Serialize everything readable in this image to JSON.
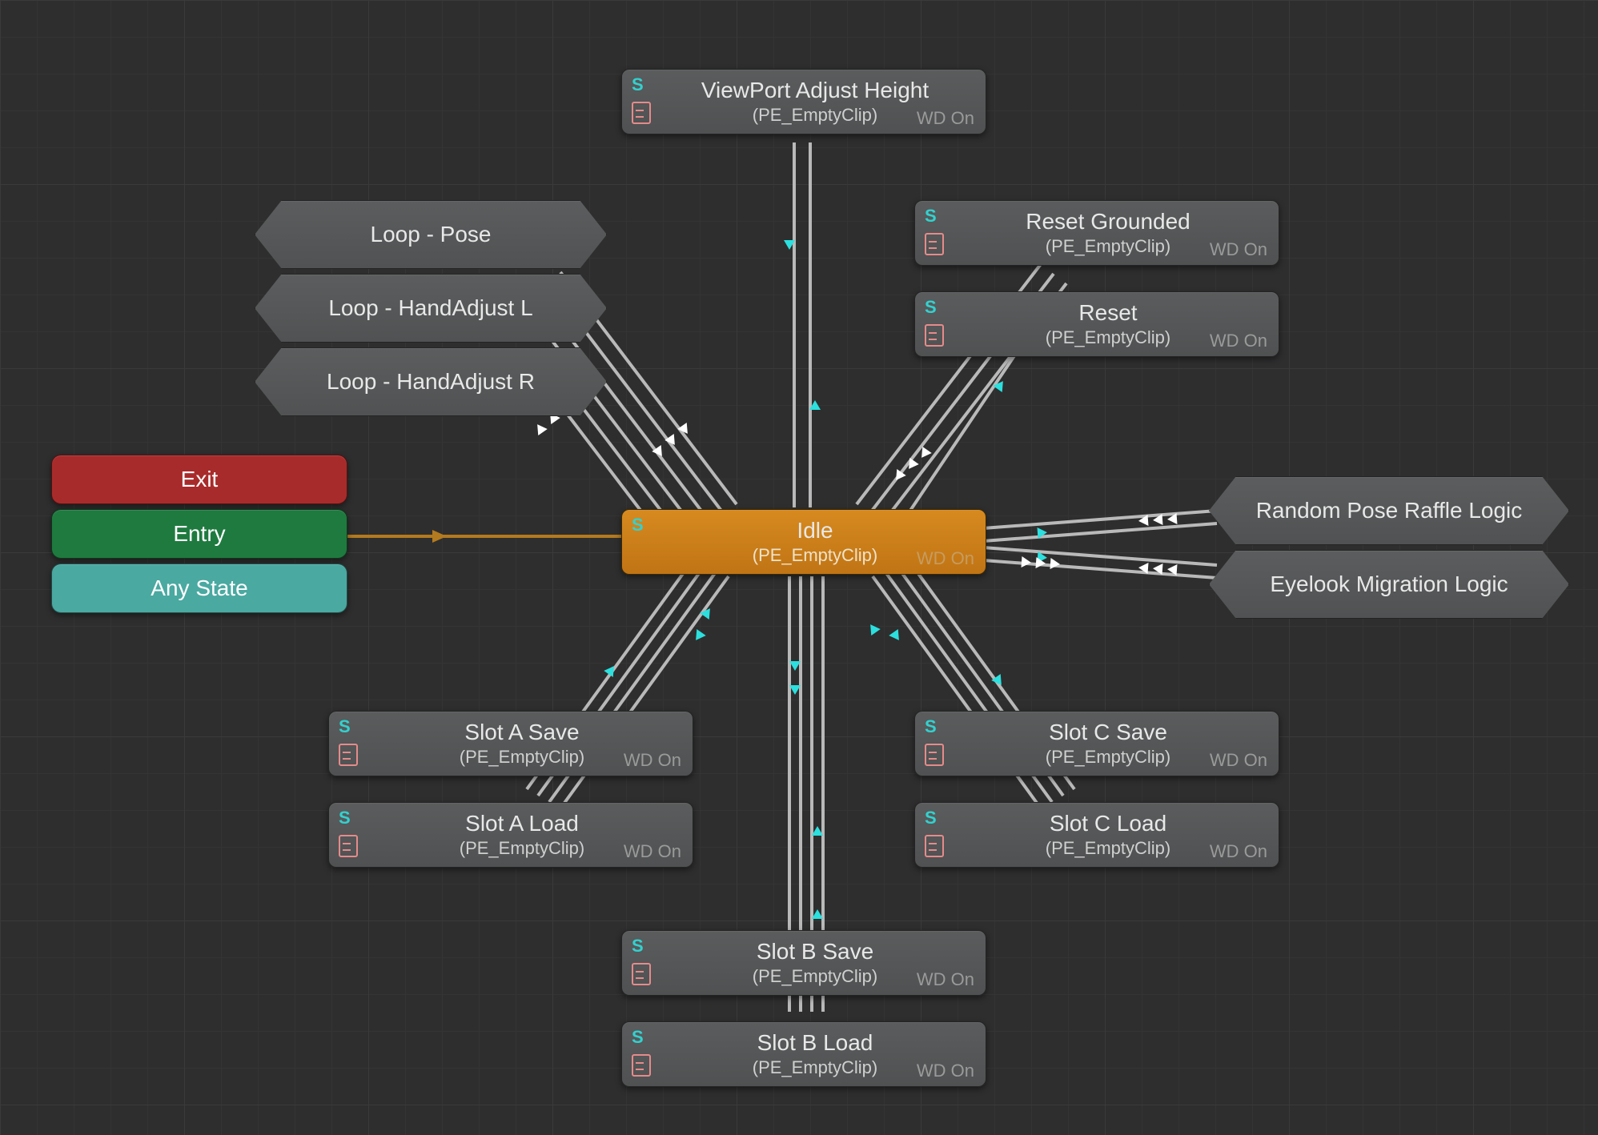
{
  "wd_on": "WD On",
  "s_glyph": "S",
  "clip": "(PE_EmptyClip)",
  "special": {
    "exit": {
      "label": "Exit",
      "color": "#a82b2b"
    },
    "entry": {
      "label": "Entry",
      "color": "#1f7a3f"
    },
    "any": {
      "label": "Any State",
      "color": "#4aa9a1"
    }
  },
  "hex": {
    "loop_pose": "Loop - Pose",
    "loop_hand_l": "Loop - HandAdjust L",
    "loop_hand_r": "Loop - HandAdjust R",
    "random_raffle": "Random Pose Raffle Logic",
    "eyelook": "Eyelook Migration Logic"
  },
  "nodes": {
    "viewport": {
      "title": "ViewPort Adjust Height"
    },
    "reset_g": {
      "title": "Reset Grounded"
    },
    "reset": {
      "title": "Reset"
    },
    "idle": {
      "title": "Idle"
    },
    "slot_a_s": {
      "title": "Slot A Save"
    },
    "slot_a_l": {
      "title": "Slot A Load"
    },
    "slot_b_s": {
      "title": "Slot B Save"
    },
    "slot_b_l": {
      "title": "Slot B Load"
    },
    "slot_c_s": {
      "title": "Slot C Save"
    },
    "slot_c_l": {
      "title": "Slot C Load"
    }
  }
}
